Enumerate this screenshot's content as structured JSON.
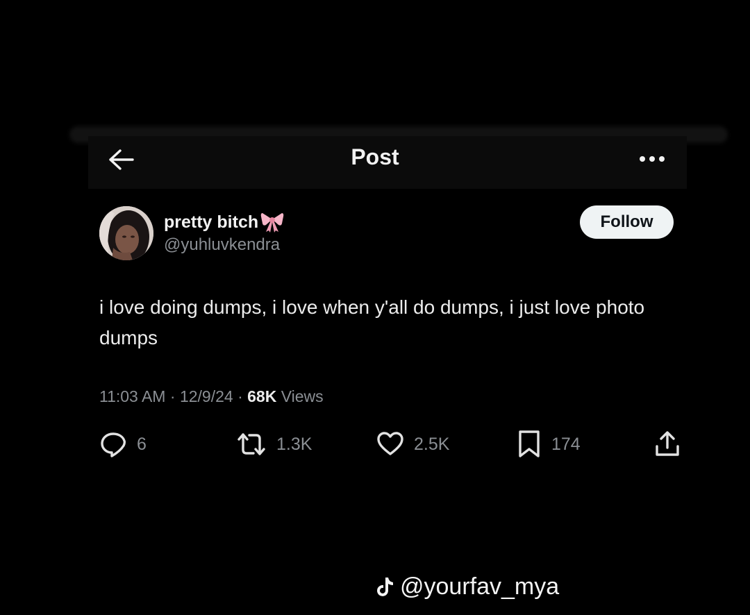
{
  "header": {
    "title": "Post"
  },
  "author": {
    "display_name": "pretty bitch",
    "handle": "@yuhluvkendra",
    "name_emoji": "🎀"
  },
  "follow_label": "Follow",
  "tweet": {
    "text": "i love doing dumps, i love when y'all do dumps, i just love photo dumps",
    "time": "11:03 AM",
    "date": "12/9/24",
    "views_count": "68K",
    "views_label": "Views"
  },
  "actions": {
    "replies": "6",
    "reposts": "1.3K",
    "likes": "2.5K",
    "bookmarks": "174"
  },
  "watermark": {
    "handle": "@yourfav_mya",
    "icon": "tiktok-icon"
  },
  "colors": {
    "background": "#000000",
    "text": "#e7e9ea",
    "muted": "#8b8f94",
    "follow_bg": "#eff3f4"
  }
}
